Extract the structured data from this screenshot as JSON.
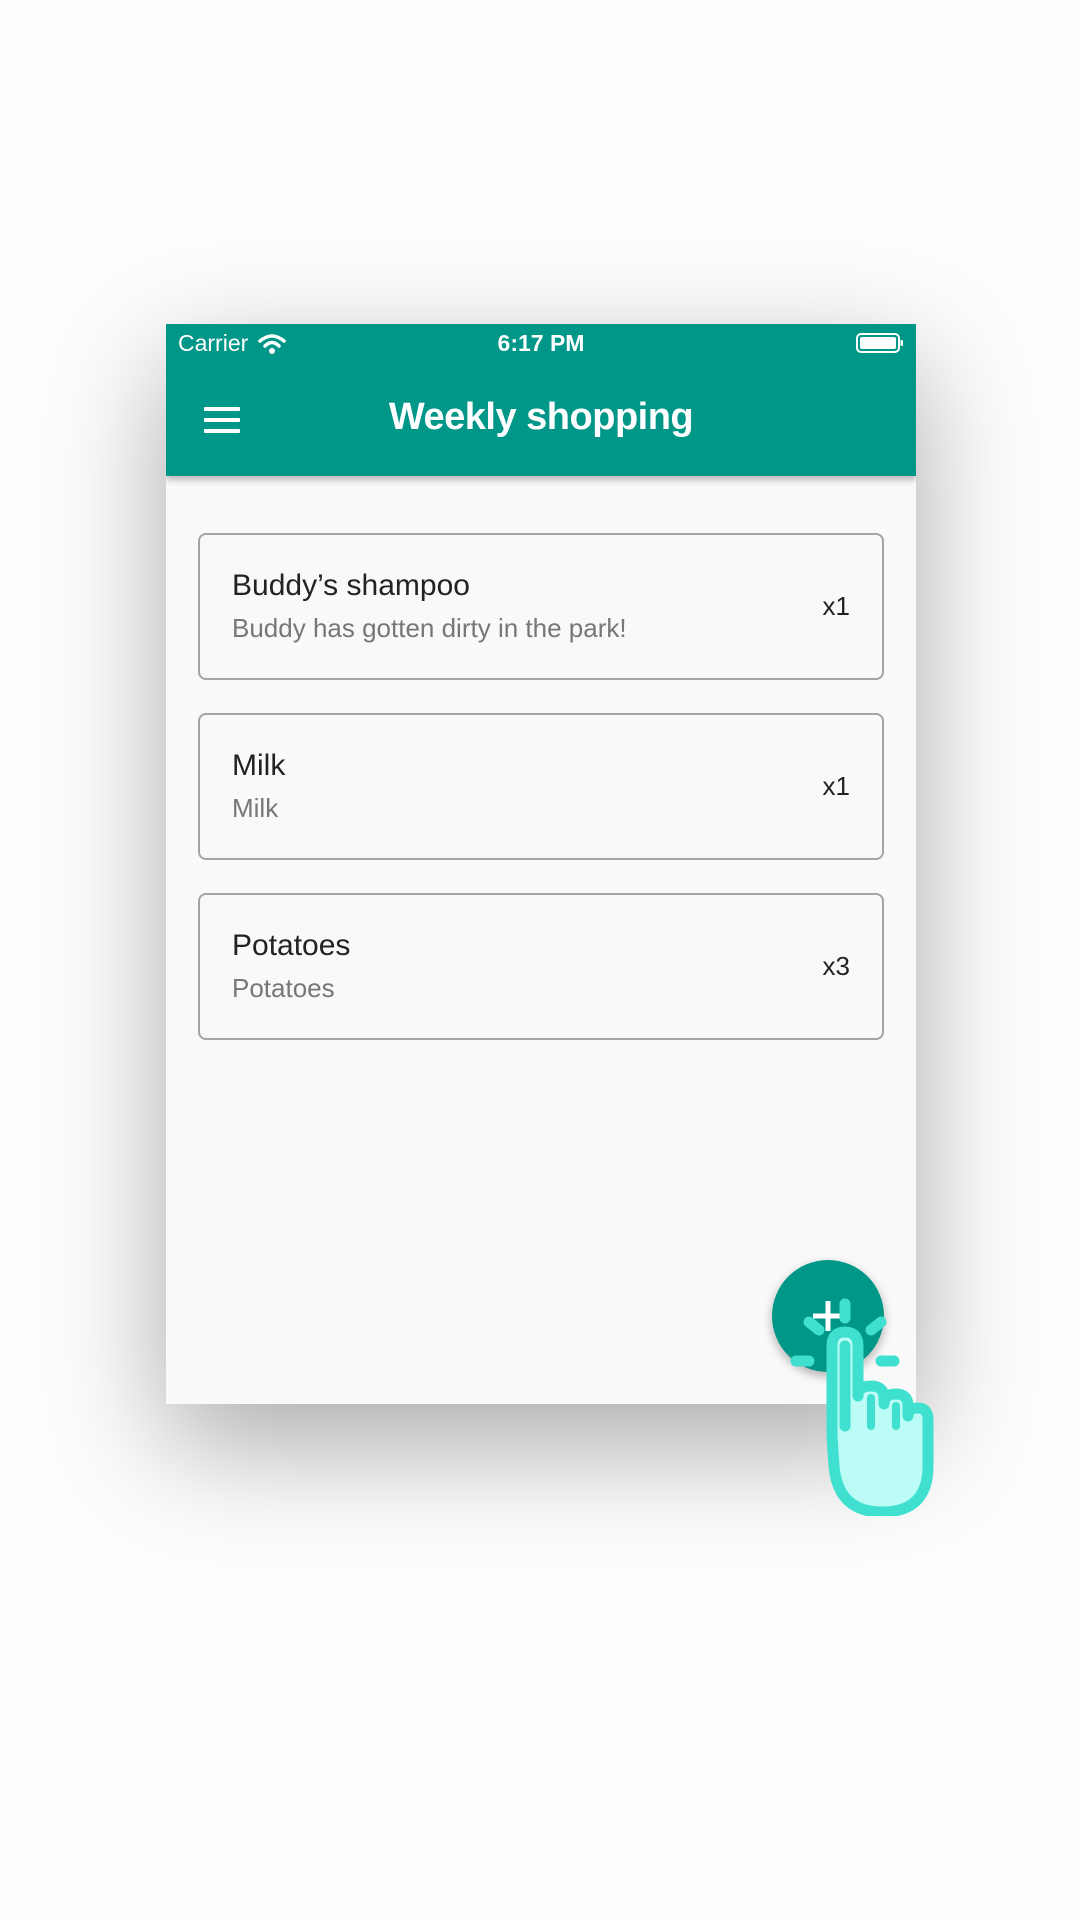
{
  "status_bar": {
    "carrier": "Carrier",
    "time": "6:17 PM"
  },
  "app_bar": {
    "title": "Weekly shopping",
    "menu_icon": "hamburger-menu-icon"
  },
  "items": [
    {
      "name": "Buddy’s shampoo",
      "description": "Buddy has gotten dirty in the park!",
      "quantity": "x1"
    },
    {
      "name": "Milk",
      "description": "Milk",
      "quantity": "x1"
    },
    {
      "name": "Potatoes",
      "description": "Potatoes",
      "quantity": "x3"
    }
  ],
  "fab": {
    "icon": "plus-icon"
  },
  "overlay": {
    "icon": "tap-hand-icon"
  },
  "colors": {
    "primary": "#009688",
    "background": "#f9f9f9",
    "hand_fill": "#bbfdf6",
    "hand_stroke": "#3fe0cf"
  }
}
